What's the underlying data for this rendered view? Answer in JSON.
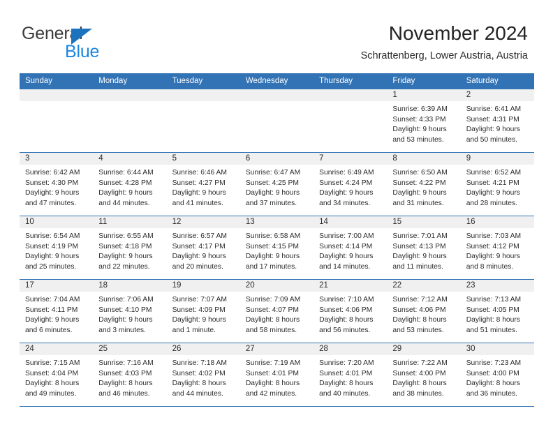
{
  "brand": {
    "name_part1": "General",
    "name_part2": "Blue",
    "triangle_color": "#1b72bf",
    "blue_color": "#1b86e0"
  },
  "header": {
    "month_title": "November 2024",
    "location": "Schrattenberg, Lower Austria, Austria"
  },
  "theme": {
    "header_blue": "#3273b5",
    "daystrip_gray": "#f0f0f0",
    "text_color": "#2b2b2b"
  },
  "calendar": {
    "weekday_headers": [
      "Sunday",
      "Monday",
      "Tuesday",
      "Wednesday",
      "Thursday",
      "Friday",
      "Saturday"
    ],
    "weeks": [
      [
        {
          "day": "",
          "lines": []
        },
        {
          "day": "",
          "lines": []
        },
        {
          "day": "",
          "lines": []
        },
        {
          "day": "",
          "lines": []
        },
        {
          "day": "",
          "lines": []
        },
        {
          "day": "1",
          "lines": [
            "Sunrise: 6:39 AM",
            "Sunset: 4:33 PM",
            "Daylight: 9 hours",
            "and 53 minutes."
          ]
        },
        {
          "day": "2",
          "lines": [
            "Sunrise: 6:41 AM",
            "Sunset: 4:31 PM",
            "Daylight: 9 hours",
            "and 50 minutes."
          ]
        }
      ],
      [
        {
          "day": "3",
          "lines": [
            "Sunrise: 6:42 AM",
            "Sunset: 4:30 PM",
            "Daylight: 9 hours",
            "and 47 minutes."
          ]
        },
        {
          "day": "4",
          "lines": [
            "Sunrise: 6:44 AM",
            "Sunset: 4:28 PM",
            "Daylight: 9 hours",
            "and 44 minutes."
          ]
        },
        {
          "day": "5",
          "lines": [
            "Sunrise: 6:46 AM",
            "Sunset: 4:27 PM",
            "Daylight: 9 hours",
            "and 41 minutes."
          ]
        },
        {
          "day": "6",
          "lines": [
            "Sunrise: 6:47 AM",
            "Sunset: 4:25 PM",
            "Daylight: 9 hours",
            "and 37 minutes."
          ]
        },
        {
          "day": "7",
          "lines": [
            "Sunrise: 6:49 AM",
            "Sunset: 4:24 PM",
            "Daylight: 9 hours",
            "and 34 minutes."
          ]
        },
        {
          "day": "8",
          "lines": [
            "Sunrise: 6:50 AM",
            "Sunset: 4:22 PM",
            "Daylight: 9 hours",
            "and 31 minutes."
          ]
        },
        {
          "day": "9",
          "lines": [
            "Sunrise: 6:52 AM",
            "Sunset: 4:21 PM",
            "Daylight: 9 hours",
            "and 28 minutes."
          ]
        }
      ],
      [
        {
          "day": "10",
          "lines": [
            "Sunrise: 6:54 AM",
            "Sunset: 4:19 PM",
            "Daylight: 9 hours",
            "and 25 minutes."
          ]
        },
        {
          "day": "11",
          "lines": [
            "Sunrise: 6:55 AM",
            "Sunset: 4:18 PM",
            "Daylight: 9 hours",
            "and 22 minutes."
          ]
        },
        {
          "day": "12",
          "lines": [
            "Sunrise: 6:57 AM",
            "Sunset: 4:17 PM",
            "Daylight: 9 hours",
            "and 20 minutes."
          ]
        },
        {
          "day": "13",
          "lines": [
            "Sunrise: 6:58 AM",
            "Sunset: 4:15 PM",
            "Daylight: 9 hours",
            "and 17 minutes."
          ]
        },
        {
          "day": "14",
          "lines": [
            "Sunrise: 7:00 AM",
            "Sunset: 4:14 PM",
            "Daylight: 9 hours",
            "and 14 minutes."
          ]
        },
        {
          "day": "15",
          "lines": [
            "Sunrise: 7:01 AM",
            "Sunset: 4:13 PM",
            "Daylight: 9 hours",
            "and 11 minutes."
          ]
        },
        {
          "day": "16",
          "lines": [
            "Sunrise: 7:03 AM",
            "Sunset: 4:12 PM",
            "Daylight: 9 hours",
            "and 8 minutes."
          ]
        }
      ],
      [
        {
          "day": "17",
          "lines": [
            "Sunrise: 7:04 AM",
            "Sunset: 4:11 PM",
            "Daylight: 9 hours",
            "and 6 minutes."
          ]
        },
        {
          "day": "18",
          "lines": [
            "Sunrise: 7:06 AM",
            "Sunset: 4:10 PM",
            "Daylight: 9 hours",
            "and 3 minutes."
          ]
        },
        {
          "day": "19",
          "lines": [
            "Sunrise: 7:07 AM",
            "Sunset: 4:09 PM",
            "Daylight: 9 hours",
            "and 1 minute."
          ]
        },
        {
          "day": "20",
          "lines": [
            "Sunrise: 7:09 AM",
            "Sunset: 4:07 PM",
            "Daylight: 8 hours",
            "and 58 minutes."
          ]
        },
        {
          "day": "21",
          "lines": [
            "Sunrise: 7:10 AM",
            "Sunset: 4:06 PM",
            "Daylight: 8 hours",
            "and 56 minutes."
          ]
        },
        {
          "day": "22",
          "lines": [
            "Sunrise: 7:12 AM",
            "Sunset: 4:06 PM",
            "Daylight: 8 hours",
            "and 53 minutes."
          ]
        },
        {
          "day": "23",
          "lines": [
            "Sunrise: 7:13 AM",
            "Sunset: 4:05 PM",
            "Daylight: 8 hours",
            "and 51 minutes."
          ]
        }
      ],
      [
        {
          "day": "24",
          "lines": [
            "Sunrise: 7:15 AM",
            "Sunset: 4:04 PM",
            "Daylight: 8 hours",
            "and 49 minutes."
          ]
        },
        {
          "day": "25",
          "lines": [
            "Sunrise: 7:16 AM",
            "Sunset: 4:03 PM",
            "Daylight: 8 hours",
            "and 46 minutes."
          ]
        },
        {
          "day": "26",
          "lines": [
            "Sunrise: 7:18 AM",
            "Sunset: 4:02 PM",
            "Daylight: 8 hours",
            "and 44 minutes."
          ]
        },
        {
          "day": "27",
          "lines": [
            "Sunrise: 7:19 AM",
            "Sunset: 4:01 PM",
            "Daylight: 8 hours",
            "and 42 minutes."
          ]
        },
        {
          "day": "28",
          "lines": [
            "Sunrise: 7:20 AM",
            "Sunset: 4:01 PM",
            "Daylight: 8 hours",
            "and 40 minutes."
          ]
        },
        {
          "day": "29",
          "lines": [
            "Sunrise: 7:22 AM",
            "Sunset: 4:00 PM",
            "Daylight: 8 hours",
            "and 38 minutes."
          ]
        },
        {
          "day": "30",
          "lines": [
            "Sunrise: 7:23 AM",
            "Sunset: 4:00 PM",
            "Daylight: 8 hours",
            "and 36 minutes."
          ]
        }
      ]
    ]
  }
}
